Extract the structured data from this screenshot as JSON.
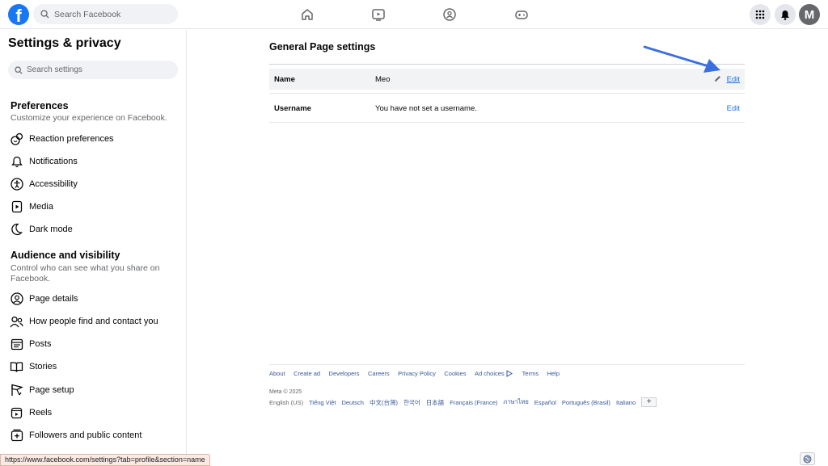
{
  "topbar": {
    "logo_letter": "f",
    "search_placeholder": "Search Facebook",
    "avatar_letter": "M"
  },
  "sidebar": {
    "title": "Settings & privacy",
    "search_placeholder": "Search settings",
    "preferences": {
      "heading": "Preferences",
      "description": "Customize your experience on Facebook.",
      "items": [
        {
          "label": "Reaction preferences",
          "icon": "reaction-icon"
        },
        {
          "label": "Notifications",
          "icon": "bell-icon"
        },
        {
          "label": "Accessibility",
          "icon": "accessibility-icon"
        },
        {
          "label": "Media",
          "icon": "media-icon"
        },
        {
          "label": "Dark mode",
          "icon": "moon-icon"
        }
      ]
    },
    "audience": {
      "heading": "Audience and visibility",
      "description": "Control who can see what you share on Facebook.",
      "items": [
        {
          "label": "Page details",
          "icon": "person-circle-icon"
        },
        {
          "label": "How people find and contact you",
          "icon": "people-icon"
        },
        {
          "label": "Posts",
          "icon": "posts-icon"
        },
        {
          "label": "Stories",
          "icon": "book-icon"
        },
        {
          "label": "Page setup",
          "icon": "flag-icon"
        },
        {
          "label": "Reels",
          "icon": "reels-icon"
        },
        {
          "label": "Followers and public content",
          "icon": "plus-box-icon"
        }
      ]
    }
  },
  "main": {
    "title": "General Page settings",
    "rows": [
      {
        "label": "Name",
        "value": "Meo",
        "action": "Edit"
      },
      {
        "label": "Username",
        "value": "You have not set a username.",
        "action": "Edit"
      }
    ]
  },
  "footer": {
    "links": [
      "About",
      "Create ad",
      "Developers",
      "Careers",
      "Privacy Policy",
      "Cookies",
      "Ad choices",
      "Terms",
      "Help"
    ],
    "copyright": "Meta © 2025",
    "current_language": "English (US)",
    "languages": [
      "Tiếng Việt",
      "Deutsch",
      "中文(台灣)",
      "한국어",
      "日本語",
      "Français (France)",
      "ภาษาไทย",
      "Español",
      "Português (Brasil)",
      "Italiano"
    ],
    "more_button": "+"
  },
  "status_url": "https://www.facebook.com/settings?tab=profile&section=name",
  "colors": {
    "brand": "#1877f2",
    "link": "#1b74e4",
    "arrow": "#3b6fe0"
  }
}
